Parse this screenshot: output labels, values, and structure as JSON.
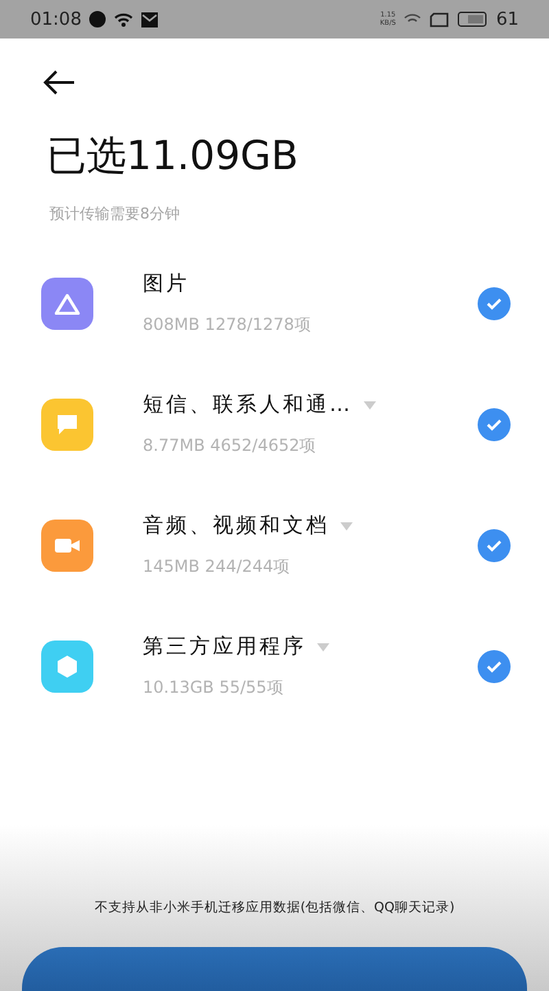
{
  "status_bar": {
    "time": "01:08",
    "speed_value": "1.15",
    "speed_unit": "KB/S",
    "battery": "61"
  },
  "header": {
    "title": "已选11.09GB",
    "subtitle": "预计传输需要8分钟"
  },
  "categories": [
    {
      "kind": "photos",
      "name": "图片",
      "details": "808MB  1278/1278项",
      "expandable": false,
      "checked": true
    },
    {
      "kind": "messages",
      "name": "短信、联系人和通…",
      "details": "8.77MB  4652/4652项",
      "expandable": true,
      "checked": true
    },
    {
      "kind": "media",
      "name": "音频、视频和文档",
      "details": "145MB  244/244项",
      "expandable": true,
      "checked": true
    },
    {
      "kind": "apps",
      "name": "第三方应用程序",
      "details": "10.13GB  55/55项",
      "expandable": true,
      "checked": true
    }
  ],
  "footer": {
    "note": "不支持从非小米手机迁移应用数据(包括微信、QQ聊天记录)"
  }
}
